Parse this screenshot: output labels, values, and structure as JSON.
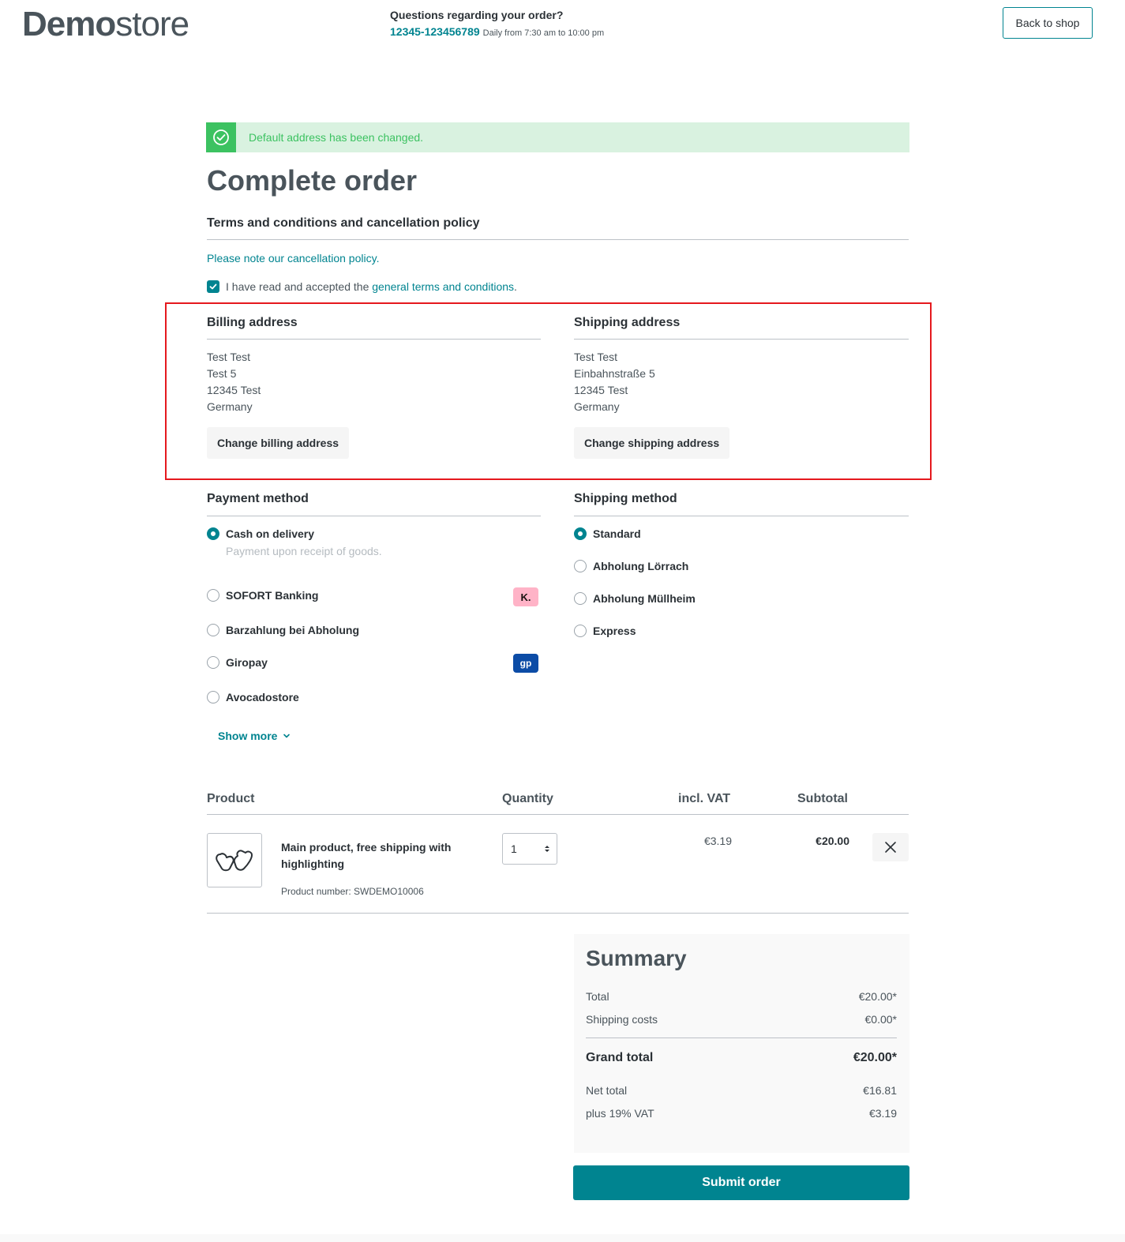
{
  "header": {
    "logo_bold": "Demo",
    "logo_light": "store",
    "question": "Questions regarding your order?",
    "phone": "12345-123456789",
    "hours": "Daily from 7:30 am to 10:00 pm",
    "back_label": "Back to shop"
  },
  "alert": {
    "text": "Default address has been changed."
  },
  "page_title": "Complete order",
  "terms": {
    "title": "Terms and conditions and cancellation policy",
    "policy_prefix": "Please note our ",
    "policy_link": "cancellation policy",
    "policy_suffix": ".",
    "accept_prefix": "I have read and accepted the ",
    "accept_link": "general terms and conditions",
    "accept_suffix": "."
  },
  "billing": {
    "title": "Billing address",
    "lines": [
      "Test Test",
      "Test 5",
      "12345 Test",
      "Germany"
    ],
    "button": "Change billing address"
  },
  "shipping": {
    "title": "Shipping address",
    "lines": [
      "Test Test",
      "Einbahnstraße 5",
      "12345 Test",
      "Germany"
    ],
    "button": "Change shipping address"
  },
  "payment": {
    "title": "Payment method",
    "options": [
      {
        "label": "Cash on delivery",
        "desc": "Payment upon receipt of goods.",
        "selected": true
      },
      {
        "label": "SOFORT Banking",
        "badge": "K.",
        "selected": false
      },
      {
        "label": "Barzahlung bei Abholung",
        "selected": false
      },
      {
        "label": "Giropay",
        "badge": "gp",
        "selected": false
      },
      {
        "label": "Avocadostore",
        "selected": false
      }
    ],
    "show_more": "Show more"
  },
  "shipping_method": {
    "title": "Shipping method",
    "options": [
      {
        "label": "Standard",
        "selected": true
      },
      {
        "label": "Abholung Lörrach",
        "selected": false
      },
      {
        "label": "Abholung Müllheim",
        "selected": false
      },
      {
        "label": "Express",
        "selected": false
      }
    ]
  },
  "cart": {
    "headers": {
      "product": "Product",
      "quantity": "Quantity",
      "vat": "incl. VAT",
      "subtotal": "Subtotal"
    },
    "item": {
      "name": "Main product, free shipping with highlighting",
      "number": "Product number: SWDEMO10006",
      "quantity": "1",
      "vat": "€3.19",
      "subtotal": "€20.00"
    }
  },
  "summary": {
    "title": "Summary",
    "total_label": "Total",
    "total_value": "€20.00*",
    "shipping_label": "Shipping costs",
    "shipping_value": "€0.00*",
    "grand_label": "Grand total",
    "grand_value": "€20.00*",
    "net_label": "Net total",
    "net_value": "€16.81",
    "vat_label": "plus 19% VAT",
    "vat_value": "€3.19"
  },
  "submit_label": "Submit order",
  "colors": {
    "accent": "#008490",
    "success": "#3cc261",
    "highlight": "#e5191e"
  }
}
